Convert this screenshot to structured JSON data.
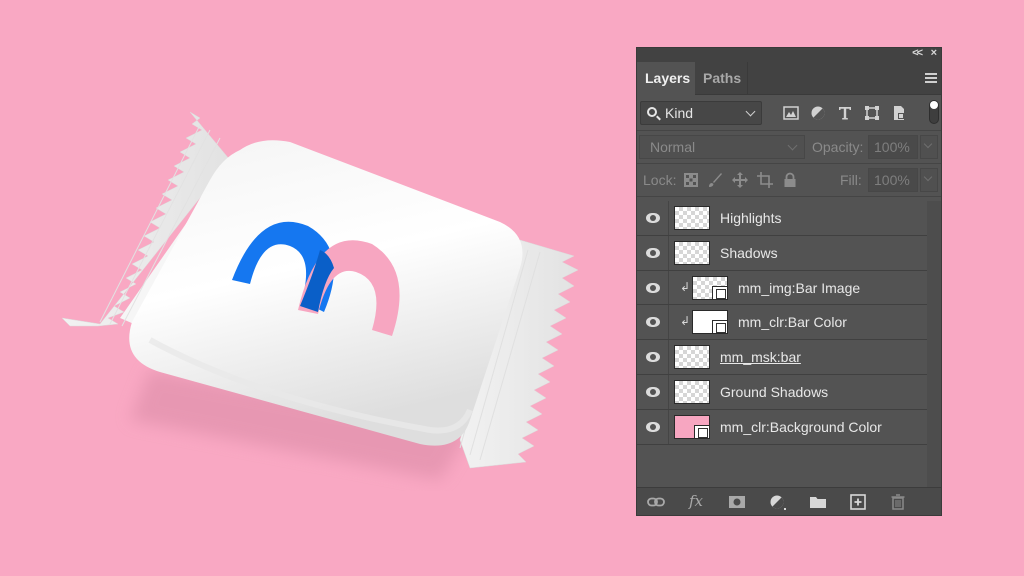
{
  "canvas": {
    "background_color": "#f9a8c3",
    "product": {
      "description": "white candy bar wrapper mockup",
      "logo": {
        "primary_color": "#1577f0",
        "secondary_color": "#f7a6c1",
        "overlap_color": "#0a5fc8"
      }
    }
  },
  "panel": {
    "title_controls": {
      "collapse": "<<",
      "close": "×"
    },
    "tabs": [
      {
        "label": "Layers",
        "active": true
      },
      {
        "label": "Paths",
        "active": false
      }
    ],
    "menu_icon": "panel-menu-icon",
    "filter": {
      "kind_label": "Kind",
      "icons": [
        "image-filter-icon",
        "adjustment-filter-icon",
        "type-filter-icon",
        "shape-filter-icon",
        "smart-object-filter-icon"
      ]
    },
    "blend_mode": "Normal",
    "opacity_label": "Opacity:",
    "opacity_value": "100%",
    "lock_label": "Lock:",
    "lock_icons": [
      "lock-transparent-icon",
      "lock-paint-icon",
      "lock-position-icon",
      "lock-artboard-icon",
      "lock-all-icon"
    ],
    "fill_label": "Fill:",
    "fill_value": "100%",
    "layers": [
      {
        "name": "Highlights",
        "visible": true,
        "clipped": false,
        "thumb": "transparent",
        "badge": false,
        "underlined": false
      },
      {
        "name": "Shadows",
        "visible": true,
        "clipped": false,
        "thumb": "transparent",
        "badge": false,
        "underlined": false
      },
      {
        "name": "mm_img:Bar Image",
        "visible": true,
        "clipped": true,
        "thumb": "transparent",
        "badge": true,
        "underlined": false
      },
      {
        "name": "mm_clr:Bar Color",
        "visible": true,
        "clipped": true,
        "thumb": "white",
        "badge": true,
        "underlined": false
      },
      {
        "name": "mm_msk:bar",
        "visible": true,
        "clipped": false,
        "thumb": "transparent",
        "badge": false,
        "underlined": true
      },
      {
        "name": "Ground Shadows",
        "visible": true,
        "clipped": false,
        "thumb": "transparent",
        "badge": false,
        "underlined": false
      },
      {
        "name": "mm_clr:Background Color",
        "visible": true,
        "clipped": false,
        "thumb": "pink",
        "badge": true,
        "underlined": false
      }
    ],
    "bottom_icons": [
      "link-layers-icon",
      "fx-icon",
      "add-mask-icon",
      "new-adjustment-icon",
      "new-group-icon",
      "new-layer-icon",
      "delete-layer-icon"
    ],
    "fx_label": "fx"
  }
}
